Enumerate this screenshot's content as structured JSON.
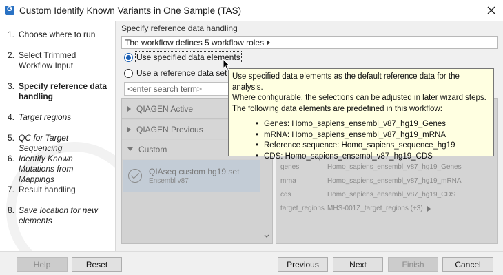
{
  "window": {
    "title": "Custom Identify Known Variants in One Sample (TAS)",
    "app_icon": "clc-workbench-icon",
    "close_icon": "close-icon"
  },
  "steps": [
    {
      "num": "1.",
      "label": "Choose where to run",
      "style": "normal"
    },
    {
      "num": "2.",
      "label": "Select Trimmed Workflow Input",
      "style": "normal"
    },
    {
      "num": "3.",
      "label": "Specify reference data handling",
      "style": "bold"
    },
    {
      "num": "4.",
      "label": "Target regions",
      "style": "italic"
    },
    {
      "num": "5.",
      "label": "QC for Target Sequencing",
      "style": "italic"
    },
    {
      "num": "6.",
      "label": "Identify Known Mutations from Mappings",
      "style": "italic"
    },
    {
      "num": "7.",
      "label": "Result handling",
      "style": "normal"
    },
    {
      "num": "8.",
      "label": "Save location for new elements",
      "style": "italic"
    }
  ],
  "main": {
    "section_title": "Specify reference data handling",
    "roles_text": "The workflow defines 5 workflow roles",
    "radio_specified": "Use specified data elements",
    "radio_reference": "Use a reference data set",
    "search_placeholder": "<enter search term>",
    "groups": {
      "active": "QIAGEN Active",
      "previous": "QIAGEN Previous",
      "custom": "Custom"
    },
    "dataset": {
      "name": "QIAseq custom hg19 set",
      "sub": "Ensembl v87"
    },
    "details": [
      {
        "key": "genes",
        "value": "Homo_sapiens_ensembl_v87_hg19_Genes"
      },
      {
        "key": "mrna",
        "value": "Homo_sapiens_ensembl_v87_hg19_mRNA"
      },
      {
        "key": "cds",
        "value": "Homo_sapiens_ensembl_v87_hg19_CDS"
      },
      {
        "key": "target_regions",
        "value": "MHS-001Z_target_regions  (+3)"
      }
    ]
  },
  "tooltip": {
    "line1": "Use specified data elements as the default reference data for the analysis.",
    "line2": "Where configurable, the selections can be adjusted in later wizard steps.",
    "line3": "The following data elements are predefined in this workflow:",
    "items": [
      "Genes: Homo_sapiens_ensembl_v87_hg19_Genes",
      "mRNA: Homo_sapiens_ensembl_v87_hg19_mRNA",
      "Reference sequence: Homo_sapiens_sequence_hg19",
      "CDS: Homo_sapiens_ensembl_v87_hg19_CDS"
    ]
  },
  "buttons": {
    "help": "Help",
    "reset": "Reset",
    "previous": "Previous",
    "next": "Next",
    "finish": "Finish",
    "cancel": "Cancel"
  }
}
